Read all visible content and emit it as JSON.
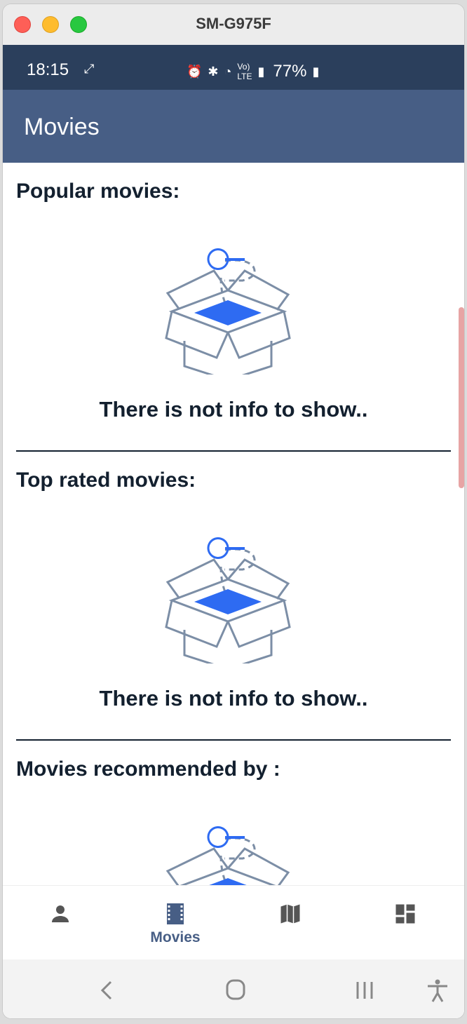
{
  "window": {
    "title": "SM-G975F"
  },
  "status_bar": {
    "time": "18:15",
    "battery": "77%"
  },
  "app_bar": {
    "title": "Movies"
  },
  "sections": [
    {
      "title": "Popular movies:",
      "empty_message": "There is not info to show.."
    },
    {
      "title": "Top rated movies:",
      "empty_message": "There is not info to show.."
    },
    {
      "title": "Movies recommended by :",
      "empty_message": ""
    }
  ],
  "bottom_nav": {
    "items": [
      {
        "icon": "person-icon",
        "label": ""
      },
      {
        "icon": "film-icon",
        "label": "Movies",
        "active": true
      },
      {
        "icon": "map-icon",
        "label": ""
      },
      {
        "icon": "dashboard-icon",
        "label": ""
      }
    ]
  },
  "colors": {
    "app_bar": "#475e85",
    "status_bar": "#2b3f5c",
    "accent": "#2e6bf2",
    "text": "#13202f"
  }
}
